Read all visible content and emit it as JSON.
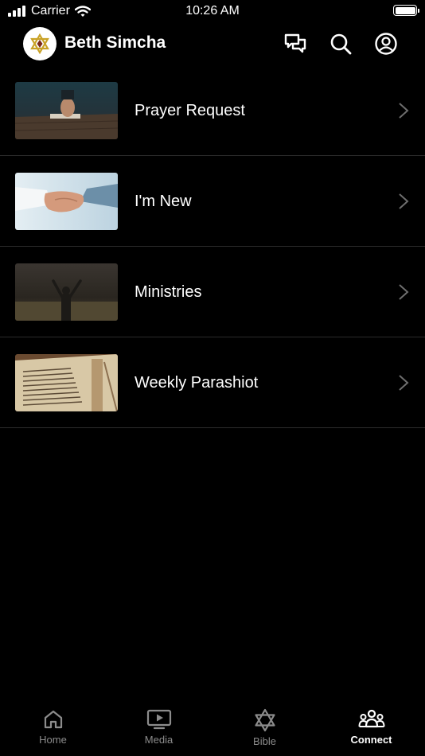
{
  "status_bar": {
    "carrier": "Carrier",
    "time": "10:26 AM"
  },
  "header": {
    "title": "Beth Simcha",
    "icons": [
      "chat-icon",
      "search-icon",
      "profile-icon"
    ]
  },
  "items": [
    {
      "label": "Prayer Request",
      "thumb": "prayer-image"
    },
    {
      "label": "I'm New",
      "thumb": "handshake-image"
    },
    {
      "label": "Ministries",
      "thumb": "worship-image"
    },
    {
      "label": "Weekly Parashiot",
      "thumb": "torah-scroll-image"
    }
  ],
  "tabs": [
    {
      "label": "Home",
      "icon": "home-icon",
      "active": false
    },
    {
      "label": "Media",
      "icon": "media-icon",
      "active": false
    },
    {
      "label": "Bible",
      "icon": "star-of-david-icon",
      "active": false
    },
    {
      "label": "Connect",
      "icon": "people-icon",
      "active": true
    }
  ],
  "colors": {
    "background": "#000000",
    "text": "#ffffff",
    "inactive_tab": "#8c8c8c",
    "divider": "#2c2c2c",
    "logo_star": "#c9a227"
  }
}
